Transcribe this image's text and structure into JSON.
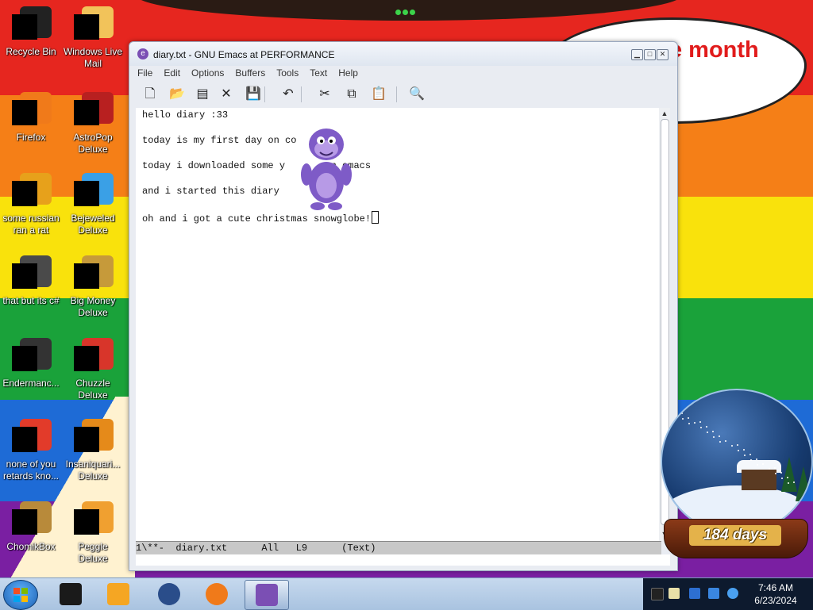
{
  "desktop": {
    "bubble_text": "e month",
    "icons": [
      {
        "label": "Recycle Bin",
        "color": "#222222"
      },
      {
        "label": "Windows Live Mail",
        "color": "#f2c35a"
      },
      {
        "label": "Firefox",
        "color": "#f07a1a"
      },
      {
        "label": "AstroPop Deluxe",
        "color": "#b82020"
      },
      {
        "label": "some russian ran a rat",
        "color": "#e7a11b"
      },
      {
        "label": "Bejeweled Deluxe",
        "color": "#3aa0e6"
      },
      {
        "label": "that but its c#",
        "color": "#4a4a4a"
      },
      {
        "label": "Big Money Deluxe",
        "color": "#c69a3a"
      },
      {
        "label": "Endermanc...",
        "color": "#333333"
      },
      {
        "label": "Chuzzle Deluxe",
        "color": "#d8352a"
      },
      {
        "label": "none of you retards kno...",
        "color": "#e23b2a"
      },
      {
        "label": "Insaniquari... Deluxe",
        "color": "#e58a1a"
      },
      {
        "label": "ChomikBox",
        "color": "#b88a3a"
      },
      {
        "label": "Peggle Deluxe",
        "color": "#f0a030"
      }
    ]
  },
  "emacs": {
    "title": "diary.txt - GNU Emacs at PERFORMANCE",
    "title_icon": "emacs-icon",
    "menu": [
      "File",
      "Edit",
      "Options",
      "Buffers",
      "Tools",
      "Text",
      "Help"
    ],
    "toolbar": [
      {
        "name": "new-file-icon",
        "glyph": "🗋"
      },
      {
        "name": "open-folder-icon",
        "glyph": "📂"
      },
      {
        "name": "dired-icon",
        "glyph": "▤"
      },
      {
        "name": "close-buffer-icon",
        "glyph": "✕"
      },
      {
        "name": "save-icon",
        "glyph": "💾"
      },
      {
        "name": "undo-icon",
        "glyph": "↶"
      },
      {
        "name": "cut-icon",
        "glyph": "✂"
      },
      {
        "name": "copy-icon",
        "glyph": "⧉"
      },
      {
        "name": "paste-icon",
        "glyph": "📋"
      },
      {
        "name": "search-icon",
        "glyph": "🔍"
      }
    ],
    "lines": [
      "hello diary :33",
      "",
      "today is my first day on co      vm",
      "",
      "today i downloaded some y       an emacs",
      "",
      "and i started this diary",
      "",
      "oh and i got a cute christmas snowglobe!"
    ],
    "modeline": "1\\**-  diary.txt      All   L9      (Text)"
  },
  "snowglobe": {
    "counter": "184 days"
  },
  "taskbar": {
    "time": "7:46 AM",
    "date": "6/23/2024",
    "items": [
      {
        "name": "taskbar-app-black",
        "color": "#1a1a1a"
      },
      {
        "name": "taskbar-app-media",
        "color": "#f5a623"
      },
      {
        "name": "taskbar-app-globe",
        "color": "#2a4d8a"
      },
      {
        "name": "taskbar-firefox",
        "color": "#f07a1a"
      },
      {
        "name": "taskbar-emacs",
        "color": "#7b4fb4"
      }
    ]
  },
  "colors": {
    "rainbow": [
      "#e6261f",
      "#f57f17",
      "#f9e20c",
      "#1aa23a",
      "#1e6bd6",
      "#7a1fa2"
    ]
  }
}
